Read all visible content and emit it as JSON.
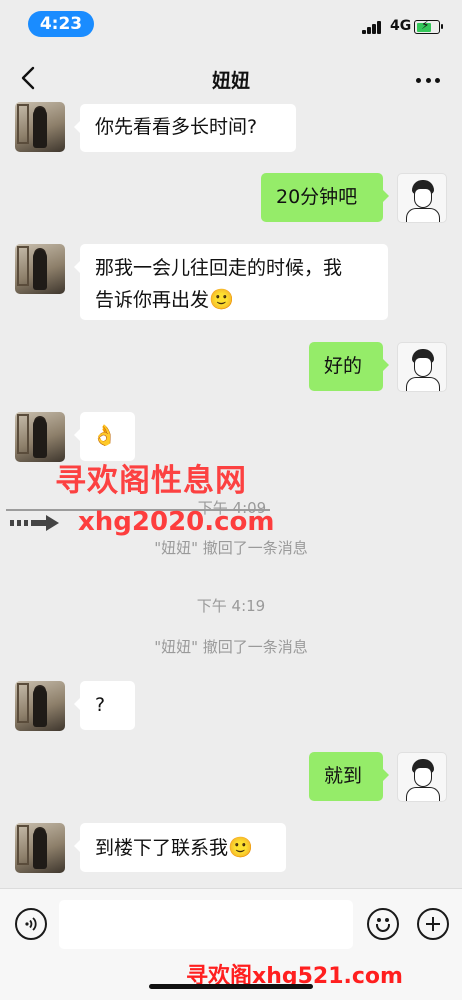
{
  "status_bar": {
    "time": "4:23",
    "network": "4G"
  },
  "header": {
    "title": "妞妞",
    "back_icon": "chevron-left-icon",
    "more_icon": "more-dots-icon"
  },
  "messages": [
    {
      "side": "left",
      "text": "你先看看多长时间?"
    },
    {
      "side": "right",
      "text": "20分钟吧"
    },
    {
      "side": "left",
      "line1": "那我一会儿往回走的时候，我",
      "line2": "告诉你再出发",
      "emoji": "🙂"
    },
    {
      "side": "right",
      "text": "好的"
    },
    {
      "side": "left",
      "emoji": "👌"
    },
    {
      "side": "left",
      "text": "?"
    },
    {
      "side": "right",
      "text": "就到"
    },
    {
      "side": "left",
      "text": "到楼下了联系我",
      "emoji": "🙂"
    }
  ],
  "system": {
    "time1": "下午 4:09",
    "recall1": "\"妞妞\" 撤回了一条消息",
    "time2": "下午 4:19",
    "recall2": "\"妞妞\" 撤回了一条消息"
  },
  "watermark": {
    "cn": "寻欢阁性息网",
    "url": "xhg2020.com",
    "bottom": "寻欢阁xhg521.com"
  },
  "input_bar": {
    "placeholder": "",
    "value": ""
  },
  "colors": {
    "accent": "#95ec69",
    "time_pill": "#1a8cff",
    "watermark": "#ff2a2a"
  }
}
